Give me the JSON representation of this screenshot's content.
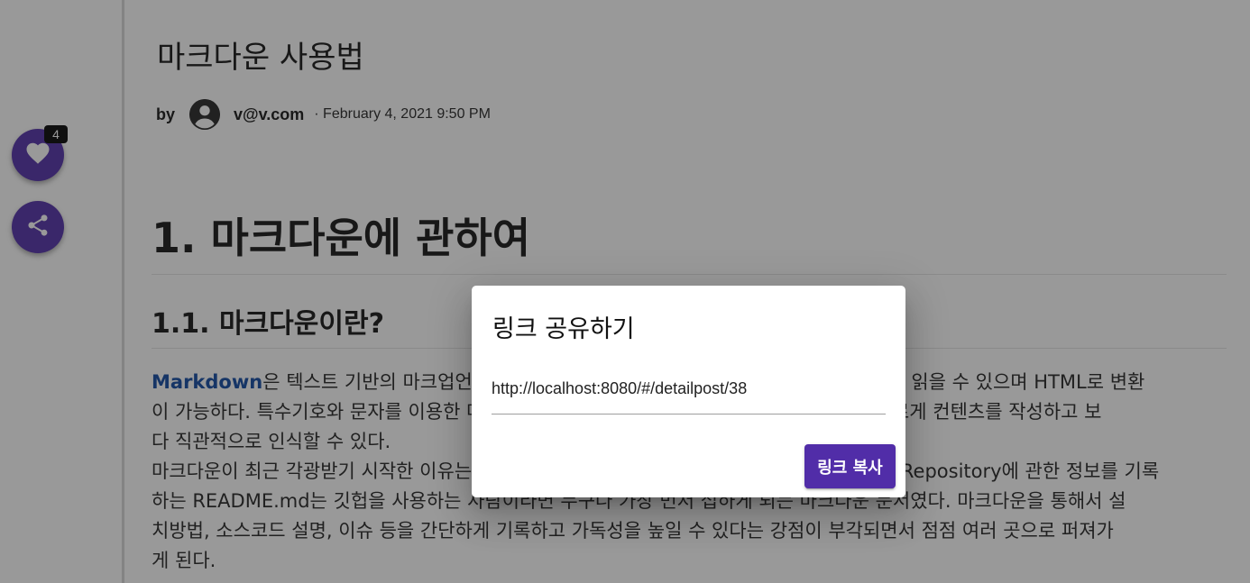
{
  "sidebar": {
    "like_count": "4",
    "like_icon": "heart-icon",
    "share_icon": "share-icon"
  },
  "post": {
    "title": "마크다운 사용법",
    "by_label": "by",
    "avatar_icon": "account-circle-icon",
    "author": "v@v.com",
    "date": "· February 4, 2021 9:50 PM",
    "h1": "1. 마크다운에 관하여",
    "h2": "1.1. 마크다운이란?",
    "paragraph": {
      "link_text": "Markdown",
      "line1_rest": "은 텍스트 기반의 마크업언어로 2004년 존그루버에 의해 만들어졌으며 쉽게 쓰고 읽을 수 있으며 HTML로 변환",
      "line2": "이 가능하다. 특수기호와 문자를 이용한 매우 간단한 구조의 문법을 사용하여 웹에서도 보다 빠르게 컨텐츠를 작성하고 보",
      "line3": "다 직관적으로 인식할 수 있다.",
      "line4": "마크다운이 최근 각광받기 시작한 이유는 깃헙(https://github.com) 덕분이다. 깃헙의 저장소Repository에 관한 정보를 기록",
      "line5": "하는 README.md는 깃헙을 사용하는 사람이라면 누구나 가장 먼저 접하게 되는 마크다운 문서였다. 마크다운을 통해서 설",
      "line6": "치방법, 소스코드 설명, 이슈 등을 간단하게 기록하고 가독성을 높일 수 있다는 강점이 부각되면서 점점 여러 곳으로 퍼져가",
      "line7": "게 된다."
    }
  },
  "dialog": {
    "title": "링크 공유하기",
    "url": "http://localhost:8080/#/detailpost/38",
    "copy_button": "링크 복사"
  },
  "colors": {
    "accent": "#512da8",
    "link": "#0d47a1",
    "scrim": "rgba(33,33,33,0.46)"
  }
}
